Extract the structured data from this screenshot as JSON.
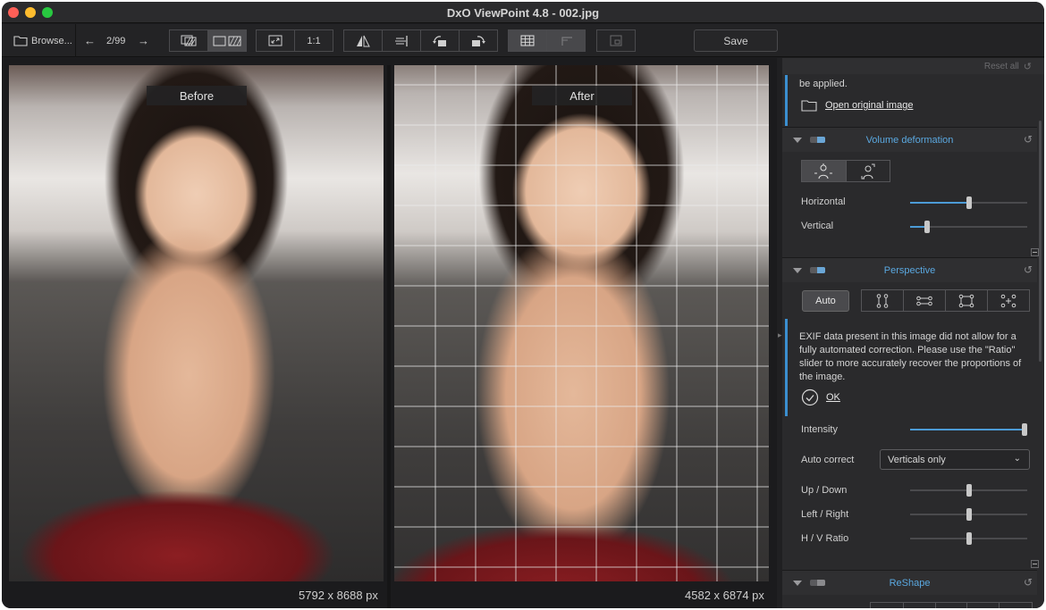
{
  "window": {
    "title": "DxO ViewPoint 4.8 - 002.jpg"
  },
  "toolbar": {
    "browse_label": "Browse...",
    "page_counter": "2/99",
    "zoom_1to1_label": "1:1",
    "save_label": "Save"
  },
  "viewer": {
    "before_label": "Before",
    "after_label": "After",
    "before_dimensions": "5792 x 8688 px",
    "after_dimensions": "4582 x 6874 px"
  },
  "panel": {
    "reset_all_label": "Reset all",
    "intro_note": {
      "text": "be applied.",
      "link": "Open original image"
    },
    "volume_deformation": {
      "title": "Volume deformation",
      "horizontal_label": "Horizontal",
      "horizontal_value": 0.5,
      "vertical_label": "Vertical",
      "vertical_value": 0.13
    },
    "perspective": {
      "title": "Perspective",
      "auto_label": "Auto",
      "exif_note": "EXIF data present in this image did not allow for a fully automated correction. Please use the \"Ratio\" slider to more accurately recover the proportions of the image.",
      "ok_label": "OK",
      "intensity_label": "Intensity",
      "intensity_value": 1.0,
      "auto_correct_label": "Auto correct",
      "auto_correct_value": "Verticals only",
      "up_down_label": "Up / Down",
      "up_down_value": 0.5,
      "left_right_label": "Left / Right",
      "left_right_value": 0.5,
      "hv_ratio_label": "H / V Ratio",
      "hv_ratio_value": 0.5
    },
    "reshape": {
      "title": "ReShape"
    }
  },
  "colors": {
    "accent": "#5aa8e0",
    "slider_fill": "#4c9bd6",
    "background": "#1d1d1f",
    "panel": "#2a2a2c"
  }
}
